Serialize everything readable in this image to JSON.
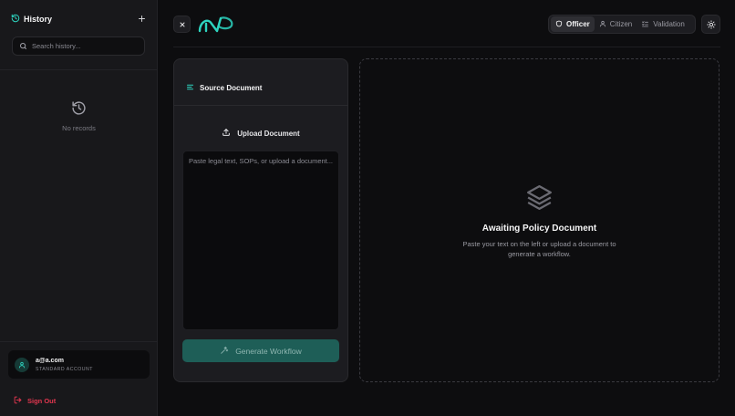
{
  "sidebar": {
    "title": "History",
    "search_placeholder": "Search history...",
    "empty_text": "No records",
    "user": {
      "email": "a@a.com",
      "role": "STANDARD ACCOUNT"
    },
    "signout_label": "Sign Out"
  },
  "topbar": {
    "modes": [
      {
        "label": "Officer",
        "icon": "shield-icon",
        "active": true
      },
      {
        "label": "Citizen",
        "icon": "user-icon",
        "active": false
      },
      {
        "label": "Validation",
        "icon": "list-check-icon",
        "active": false
      }
    ]
  },
  "source": {
    "title": "Source Document",
    "upload_label": "Upload Document",
    "text_placeholder": "Paste legal text, SOPs, or upload a document...",
    "generate_label": "Generate Workflow"
  },
  "output": {
    "title": "Awaiting Policy Document",
    "description": "Paste your text on the left or upload a document to generate a workflow."
  },
  "colors": {
    "accent": "#2dd4bf",
    "danger": "#e1364f",
    "generate_button": "#1e5e57"
  }
}
